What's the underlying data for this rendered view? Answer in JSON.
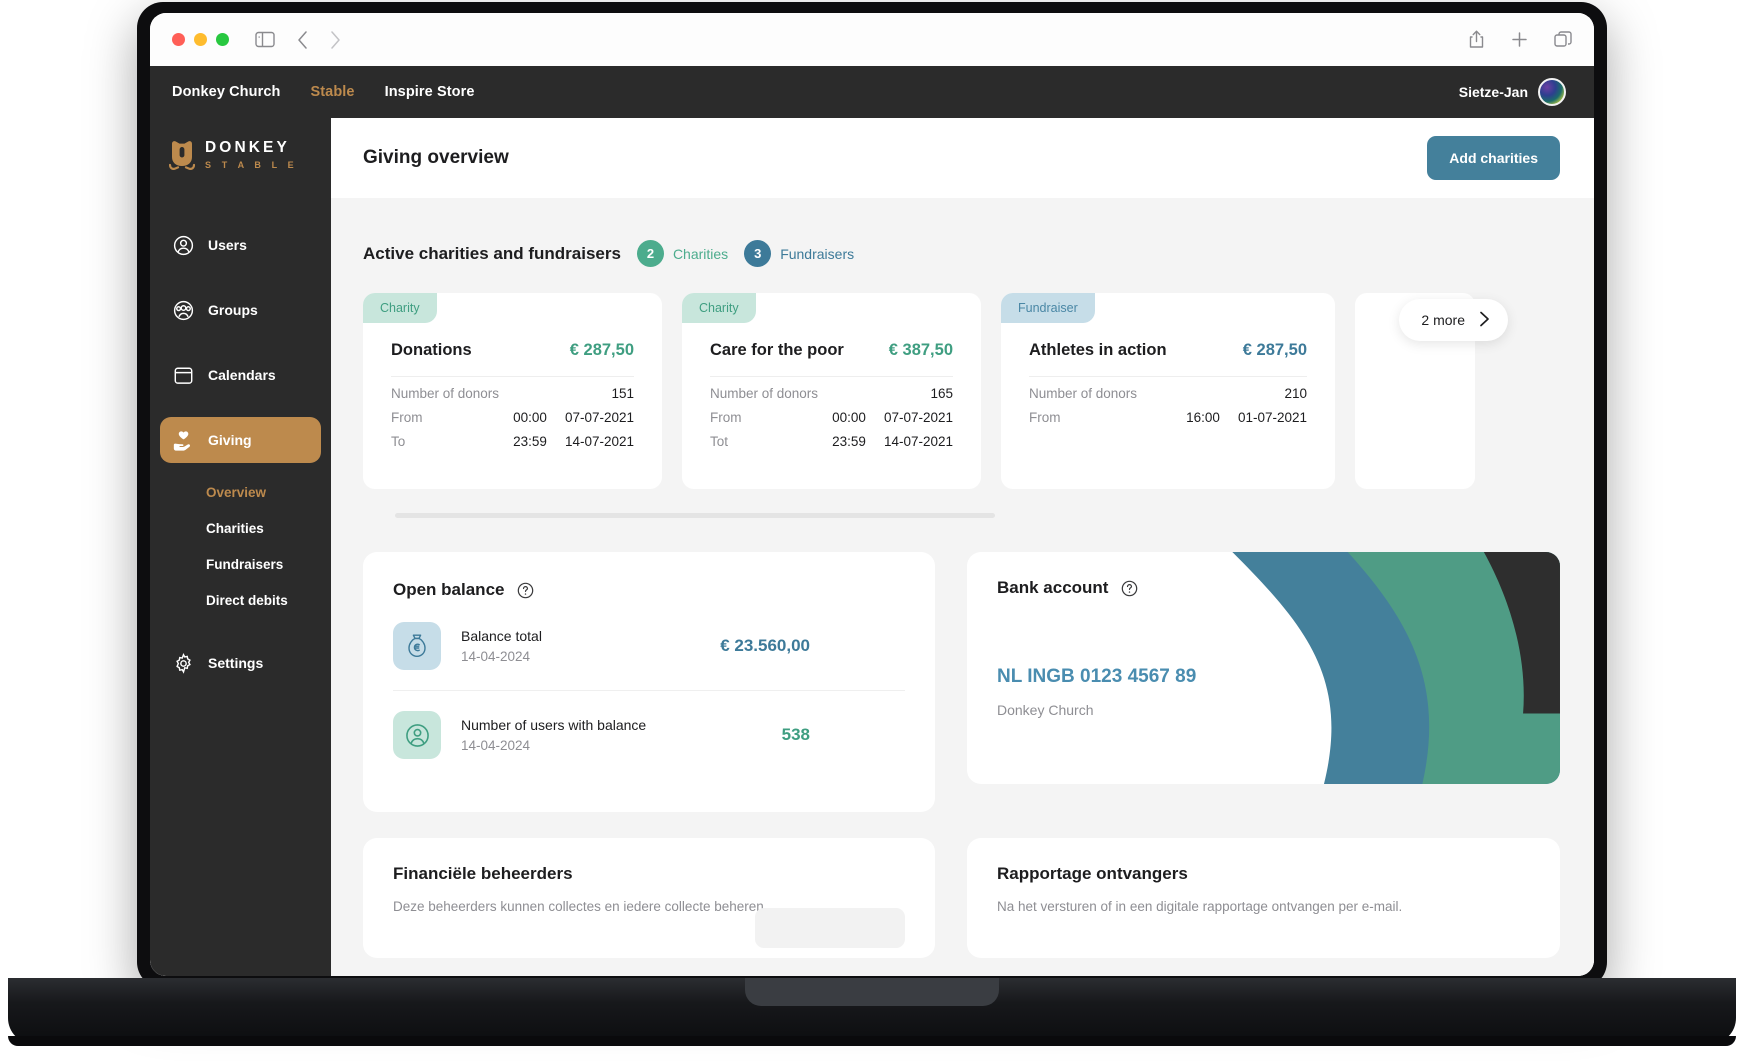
{
  "browser": {
    "sidebar_toggle_icon": "sidebar-icon",
    "back_icon": "chevron-left-icon",
    "forward_icon": "chevron-right-icon",
    "share_icon": "share-icon",
    "new_tab_icon": "plus-icon",
    "tabs_icon": "copy-icon"
  },
  "topbar": {
    "links": [
      {
        "label": "Donkey Church",
        "accent": false
      },
      {
        "label": "Stable",
        "accent": true
      },
      {
        "label": "Inspire Store",
        "accent": false
      }
    ],
    "user_name": "Sietze-Jan"
  },
  "sidebar": {
    "brand_title": "DONKEY",
    "brand_sub": "S T A B L E",
    "items": [
      {
        "label": "Users",
        "icon": "user-circle-icon",
        "active": false
      },
      {
        "label": "Groups",
        "icon": "users-group-icon",
        "active": false
      },
      {
        "label": "Calendars",
        "icon": "calendar-icon",
        "active": false
      },
      {
        "label": "Giving",
        "icon": "hand-heart-icon",
        "active": true
      },
      {
        "label": "Settings",
        "icon": "gear-icon",
        "active": false
      }
    ],
    "subitems": [
      {
        "label": "Overview",
        "active": true
      },
      {
        "label": "Charities",
        "active": false
      },
      {
        "label": "Fundraisers",
        "active": false
      },
      {
        "label": "Direct debits",
        "active": false
      }
    ]
  },
  "page": {
    "title": "Giving overview",
    "add_button": "Add charities"
  },
  "section": {
    "title": "Active charities and fundraisers",
    "charities_count": "2",
    "charities_label": "Charities",
    "fundraisers_count": "3",
    "fundraisers_label": "Fundraisers",
    "more_label": "2 more",
    "more_icon": "chevron-right-icon"
  },
  "cards": [
    {
      "tag": "Charity",
      "tag_type": "charity",
      "name": "Donations",
      "amount": "€ 287,50",
      "donors_label": "Number of donors",
      "donors_value": "151",
      "from_label": "From",
      "from_time": "00:00",
      "from_date": "07-07-2021",
      "to_label": "To",
      "to_time": "23:59",
      "to_date": "14-07-2021"
    },
    {
      "tag": "Charity",
      "tag_type": "charity",
      "name": "Care for the poor",
      "amount": "€ 387,50",
      "donors_label": "Number of donors",
      "donors_value": "165",
      "from_label": "From",
      "from_time": "00:00",
      "from_date": "07-07-2021",
      "to_label": "Tot",
      "to_time": "23:59",
      "to_date": "14-07-2021"
    },
    {
      "tag": "Fundraiser",
      "tag_type": "fundraiser",
      "name": "Athletes in action",
      "amount": "€ 287,50",
      "donors_label": "Number of donors",
      "donors_value": "210",
      "from_label": "From",
      "from_time": "16:00",
      "from_date": "01-07-2021",
      "to_label": "",
      "to_time": "",
      "to_date": ""
    }
  ],
  "open_balance": {
    "title": "Open balance",
    "help_icon": "question-circle-icon",
    "rows": [
      {
        "icon": "money-bag-icon",
        "label": "Balance total",
        "date": "14-04-2024",
        "value": "€ 23.560,00",
        "color": "blue"
      },
      {
        "icon": "user-circle-icon",
        "label": "Number of users with balance",
        "date": "14-04-2024",
        "value": "538",
        "color": "green"
      }
    ]
  },
  "bank_account": {
    "title": "Bank account",
    "help_icon": "question-circle-icon",
    "iban": "NL INGB 0123 4567 89",
    "owner": "Donkey Church"
  },
  "bottom_panels": [
    {
      "title": "Financiële beheerders",
      "subtitle": "Deze beheerders kunnen collectes en iedere collecte beheren."
    },
    {
      "title": "Rapportage ontvangers",
      "subtitle": "Na het versturen of in een digitale rapportage ontvangen per e-mail."
    }
  ],
  "colors": {
    "accent_gold": "#bd8a4d",
    "green": "#3f9e81",
    "blue": "#3d7a99",
    "button_blue": "#44809b",
    "dark": "#2b2b2b"
  }
}
